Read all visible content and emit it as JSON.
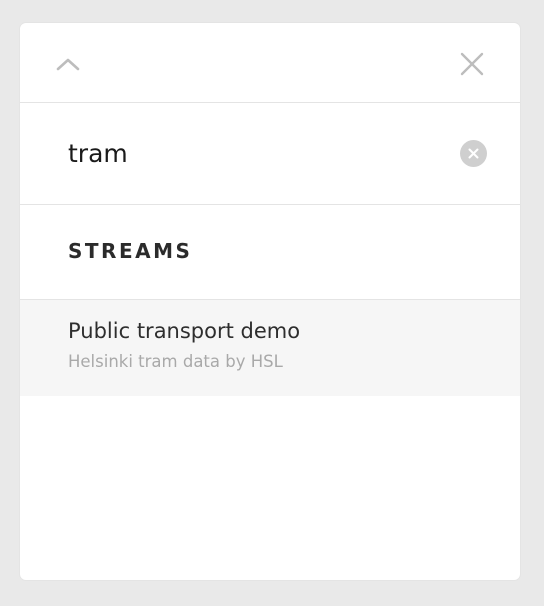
{
  "panel": {
    "collapse_icon": "chevron-up-icon",
    "close_icon": "close-icon"
  },
  "search": {
    "value": "tram",
    "clear_icon": "clear-circle-icon"
  },
  "section": {
    "title": "STREAMS"
  },
  "results": [
    {
      "title": "Public transport demo",
      "subtitle": "Helsinki tram data by HSL"
    }
  ],
  "colors": {
    "background": "#e9e9e9",
    "panel": "#ffffff",
    "divider": "#e4e4e4",
    "result_highlight": "#f6f6f6",
    "muted_text": "#a9a9a9",
    "icon": "#bdbdbd"
  }
}
